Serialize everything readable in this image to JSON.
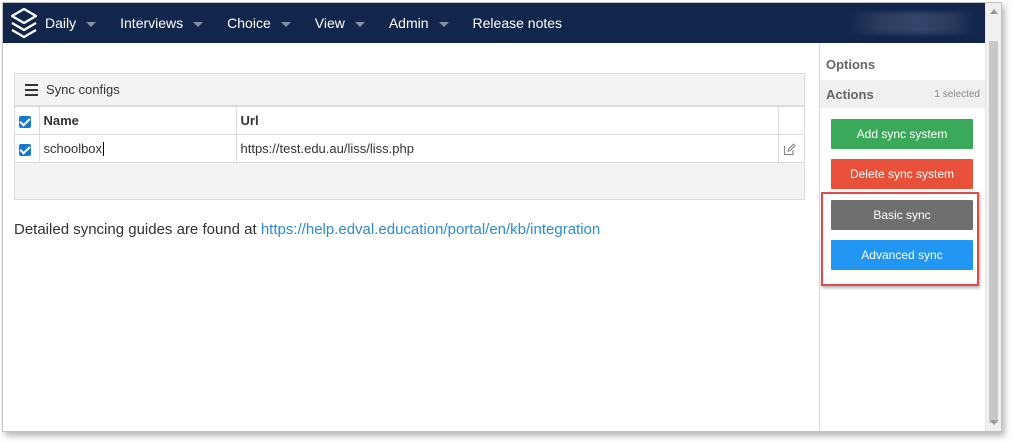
{
  "navbar": {
    "logo_icon": "stacked-layers-icon",
    "items": [
      {
        "label": "Daily",
        "has_dropdown": true
      },
      {
        "label": "Interviews",
        "has_dropdown": true
      },
      {
        "label": "Choice",
        "has_dropdown": true
      },
      {
        "label": "View",
        "has_dropdown": true
      },
      {
        "label": "Admin",
        "has_dropdown": true
      },
      {
        "label": "Release notes",
        "has_dropdown": false
      }
    ]
  },
  "panel": {
    "title": "Sync configs",
    "title_icon": "list-icon",
    "columns": {
      "name": "Name",
      "url": "Url"
    },
    "header_checked": true,
    "rows": [
      {
        "checked": true,
        "name": "schoolbox",
        "url": "https://test.edu.au/liss/liss.php",
        "edit_icon": "edit-icon"
      }
    ]
  },
  "guide": {
    "text": "Detailed syncing guides are found at ",
    "link": "https://help.edval.education/portal/en/kb/integration"
  },
  "sidebar": {
    "options_label": "Options",
    "actions_label": "Actions",
    "selected_count": "1 selected",
    "buttons": {
      "add": "Add sync system",
      "delete": "Delete sync system",
      "basic": "Basic sync",
      "advanced": "Advanced sync"
    }
  },
  "colors": {
    "navbar_bg": "#12264c",
    "add_button": "#3aaa5a",
    "delete_button": "#e8503a",
    "basic_button": "#6f6f6f",
    "advanced_button": "#2196f3",
    "link": "#2b8ccf",
    "highlight": "#e24a4a"
  }
}
